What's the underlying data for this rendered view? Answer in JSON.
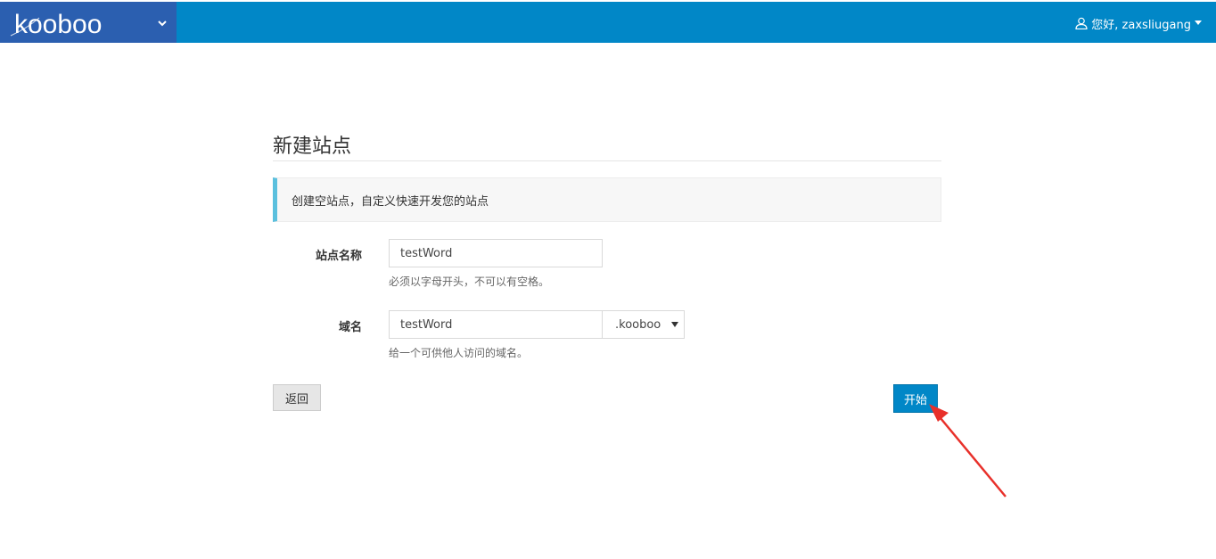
{
  "header": {
    "brand": "kooboo",
    "user_greeting": "您好, zaxsliugang"
  },
  "page": {
    "title": "新建站点",
    "description": "创建空站点，自定义快速开发您的站点"
  },
  "form": {
    "site_name": {
      "label": "站点名称",
      "value": "testWord",
      "help": "必须以字母开头，不可以有空格。"
    },
    "domain": {
      "label": "域名",
      "value": "testWord",
      "suffix": ".kooboo",
      "help": "给一个可供他人访问的域名。"
    }
  },
  "actions": {
    "back_label": "返回",
    "start_label": "开始"
  },
  "colors": {
    "header_bg": "#0187c7",
    "brand_bg": "#2b5fb0",
    "callout_accent": "#5bc0de",
    "annotation_arrow": "#e8302a"
  },
  "icons": {
    "user": "user-icon",
    "toggle": "chevron-down-icon",
    "caret": "caret-down-icon",
    "select": "select-arrow-icon"
  }
}
